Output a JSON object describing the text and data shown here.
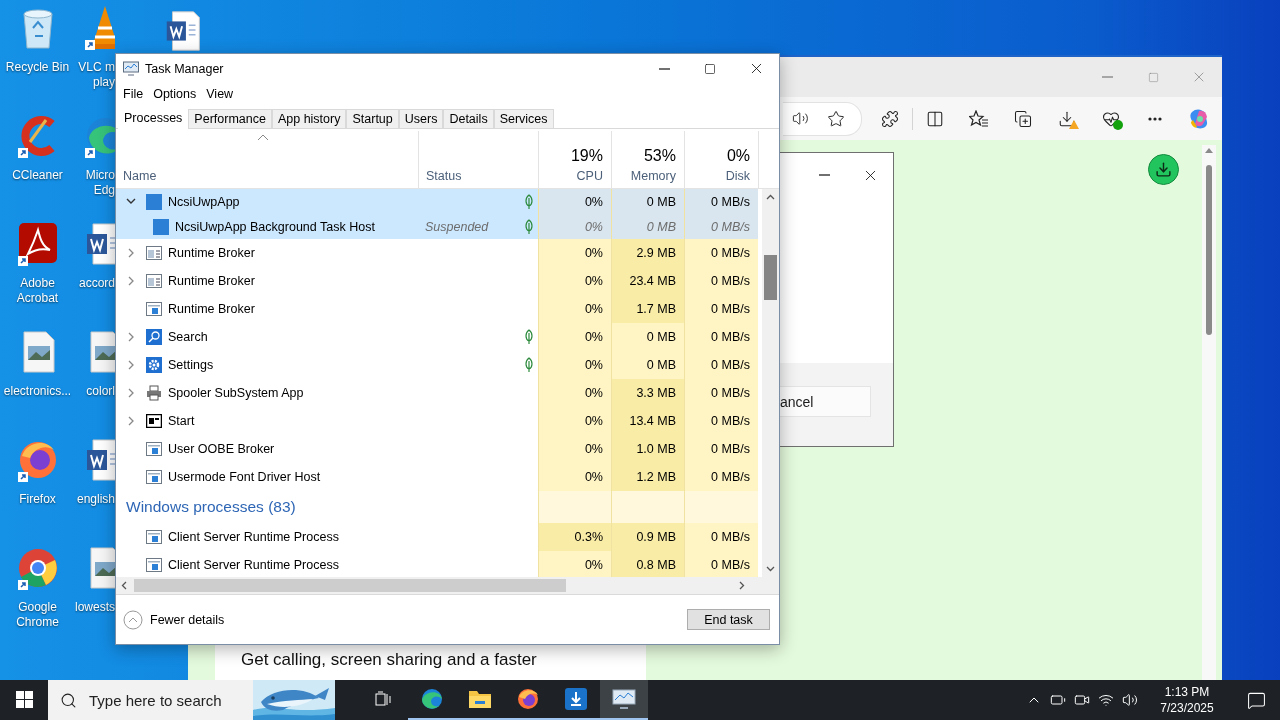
{
  "desktop": {
    "icons": [
      {
        "lines": [
          "Recycle Bin"
        ]
      },
      {
        "lines": [
          "CCleaner"
        ]
      },
      {
        "lines": [
          "Adobe",
          "Acrobat"
        ]
      },
      {
        "lines": [
          "electronics..."
        ]
      },
      {
        "lines": [
          "Firefox"
        ]
      },
      {
        "lines": [
          "Google",
          "Chrome"
        ]
      }
    ],
    "icons_cut": [
      {
        "lines": [
          "VLC m",
          "play"
        ]
      },
      {
        "lines": [
          "Micro",
          "Edg"
        ]
      },
      {
        "lines": [
          "accord"
        ]
      },
      {
        "lines": [
          "colorl"
        ]
      },
      {
        "lines": [
          "english"
        ]
      },
      {
        "lines": [
          "lowests"
        ]
      }
    ]
  },
  "browser": {
    "dialog": {
      "button": "ancel"
    },
    "card": {
      "text": "Get calling, screen sharing and a faster"
    }
  },
  "task_manager": {
    "title": "Task Manager",
    "menu": [
      "File",
      "Options",
      "View"
    ],
    "tabs": [
      {
        "label": "Processes",
        "selected": true
      },
      {
        "label": "Performance",
        "selected": false
      },
      {
        "label": "App history",
        "selected": false
      },
      {
        "label": "Startup",
        "selected": false
      },
      {
        "label": "Users",
        "selected": false
      },
      {
        "label": "Details",
        "selected": false
      },
      {
        "label": "Services",
        "selected": false
      }
    ],
    "columns": [
      {
        "label": "Name"
      },
      {
        "label": "Status"
      },
      {
        "label": "CPU",
        "usage": "19%"
      },
      {
        "label": "Memory",
        "usage": "53%"
      },
      {
        "label": "Disk",
        "usage": "0%"
      }
    ],
    "sections": [
      {
        "rows": [
          {
            "name": "NcsiUwpApp",
            "status": "",
            "leaf": true,
            "kind": "group",
            "expanded": true,
            "selected": true,
            "suspended": false,
            "cpu": "0%",
            "memory": "0 MB",
            "disk": "0 MB/s",
            "busy": [
              false,
              false,
              false
            ],
            "children": [
              {
                "name": "NcsiUwpApp Background Task Host",
                "status": "Suspended",
                "leaf": true,
                "selected": true,
                "suspended": true,
                "cpu": "0%",
                "memory": "0 MB",
                "disk": "0 MB/s",
                "busy": [
                  false,
                  false,
                  false
                ]
              }
            ]
          },
          {
            "name": "Runtime Broker",
            "leaf": false,
            "kind": "group",
            "expanded": false,
            "selected": false,
            "suspended": false,
            "cpu": "0%",
            "memory": "2.9 MB",
            "disk": "0 MB/s",
            "busy": [
              false,
              true,
              false
            ]
          },
          {
            "name": "Runtime Broker",
            "leaf": false,
            "kind": "group",
            "expanded": false,
            "selected": false,
            "suspended": false,
            "cpu": "0%",
            "memory": "23.4 MB",
            "disk": "0 MB/s",
            "busy": [
              false,
              true,
              false
            ]
          },
          {
            "name": "Runtime Broker",
            "leaf": false,
            "kind": "single",
            "selected": false,
            "suspended": false,
            "cpu": "0%",
            "memory": "1.7 MB",
            "disk": "0 MB/s",
            "busy": [
              false,
              true,
              false
            ]
          },
          {
            "name": "Search",
            "leaf": true,
            "kind": "group",
            "expanded": false,
            "selected": false,
            "suspended": false,
            "cpu": "0%",
            "memory": "0 MB",
            "disk": "0 MB/s",
            "busy": [
              false,
              false,
              false
            ]
          },
          {
            "name": "Settings",
            "leaf": true,
            "kind": "group",
            "expanded": false,
            "selected": false,
            "suspended": false,
            "cpu": "0%",
            "memory": "0 MB",
            "disk": "0 MB/s",
            "busy": [
              false,
              false,
              false
            ]
          },
          {
            "name": "Spooler SubSystem App",
            "leaf": false,
            "kind": "group",
            "expanded": false,
            "selected": false,
            "suspended": false,
            "cpu": "0%",
            "memory": "3.3 MB",
            "disk": "0 MB/s",
            "busy": [
              false,
              true,
              false
            ]
          },
          {
            "name": "Start",
            "leaf": false,
            "kind": "group",
            "expanded": false,
            "selected": false,
            "suspended": false,
            "cpu": "0%",
            "memory": "13.4 MB",
            "disk": "0 MB/s",
            "busy": [
              false,
              true,
              false
            ]
          },
          {
            "name": "User OOBE Broker",
            "leaf": false,
            "kind": "single",
            "selected": false,
            "suspended": false,
            "cpu": "0%",
            "memory": "1.0 MB",
            "disk": "0 MB/s",
            "busy": [
              false,
              true,
              false
            ]
          },
          {
            "name": "Usermode Font Driver Host",
            "leaf": false,
            "kind": "single",
            "selected": false,
            "suspended": false,
            "cpu": "0%",
            "memory": "1.2 MB",
            "disk": "0 MB/s",
            "busy": [
              false,
              true,
              false
            ]
          }
        ]
      },
      {
        "heading": "Windows processes (83)",
        "rows": [
          {
            "name": "Client Server Runtime Process",
            "leaf": false,
            "kind": "single",
            "selected": false,
            "suspended": false,
            "cpu": "0.3%",
            "memory": "0.9 MB",
            "disk": "0 MB/s",
            "busy": [
              true,
              true,
              false
            ]
          },
          {
            "name": "Client Server Runtime Process",
            "leaf": false,
            "kind": "single",
            "selected": false,
            "suspended": false,
            "cpu": "0%",
            "memory": "0.8 MB",
            "disk": "0 MB/s",
            "busy": [
              false,
              true,
              false
            ]
          }
        ]
      }
    ],
    "footer": {
      "toggle": "Fewer details",
      "button": "End task"
    }
  },
  "taskbar": {
    "search": {
      "placeholder": "Type here to search"
    },
    "apps": [
      {
        "running": false,
        "selected": false
      },
      {
        "running": true,
        "selected": false
      },
      {
        "running": true,
        "selected": false
      },
      {
        "running": true,
        "selected": false
      },
      {
        "running": true,
        "selected": false
      },
      {
        "running": true,
        "selected": true
      }
    ],
    "clock": {
      "time": "1:13 PM",
      "date": "7/23/2025"
    }
  }
}
